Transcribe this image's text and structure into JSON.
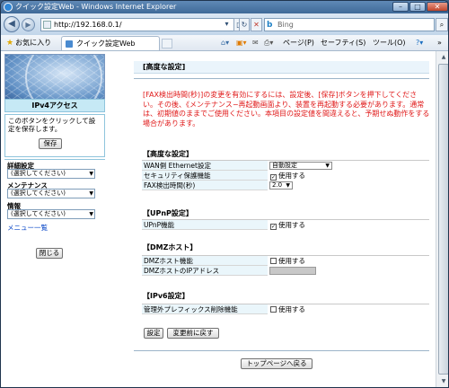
{
  "window": {
    "title": "クイック設定Web - Windows Internet Explorer"
  },
  "addressbar": {
    "url": "http://192.168.0.1/"
  },
  "searchbar": {
    "engine_label": "Bing"
  },
  "favorites": {
    "label": "お気に入り",
    "tab_label": "クイック設定Web",
    "commands": [
      "ページ(P)",
      "セーフティ(S)",
      "ツール(O)"
    ]
  },
  "sidebar": {
    "mode": "IPv4アクセス",
    "save_hint": "このボタンをクリックして設定を保存します。",
    "save_label": "保存",
    "menus": [
      {
        "label": "詳細設定",
        "placeholder": "(選択してください)"
      },
      {
        "label": "メンテナンス",
        "placeholder": "(選択してください)"
      },
      {
        "label": "情報",
        "placeholder": "(選択してください)"
      }
    ],
    "menu_list_link": "メニュー一覧",
    "close_label": "閉じる"
  },
  "page": {
    "title": "[高度な設定]",
    "warning": "[FAX検出時間(秒)]の変更を有効にするには、設定後、[保存]ボタンを押下してください。その後、《メンテナンス−再起動画面より、装置を再起動する必要があります。通常は、初期値のままでご使用ください。本項目の設定値を間違えると、予期せぬ動作をする場合があります。",
    "sections": {
      "advanced": {
        "title": "【高度な設定】",
        "wan_label": "WAN側 Ethernet設定",
        "wan_value": "自動設定",
        "security_label": "セキュリティ保護機能",
        "security_check": "使用する",
        "fax_label": "FAX検出時間(秒)",
        "fax_value": "2.0"
      },
      "upnp": {
        "title": "【UPnP設定】",
        "label": "UPnP機能",
        "check": "使用する"
      },
      "dmz": {
        "title": "【DMZホスト】",
        "label": "DMZホスト機能",
        "check": "使用する",
        "ip_label": "DMZホストのIPアドレス",
        "ip_value": ""
      },
      "ipv6": {
        "title": "【IPv6設定】",
        "label": "管理外プレフィックス削除機能",
        "check": "使用する"
      }
    },
    "buttons": {
      "apply": "設定",
      "revert": "変更前に戻す",
      "top": "トップページへ戻る"
    }
  }
}
